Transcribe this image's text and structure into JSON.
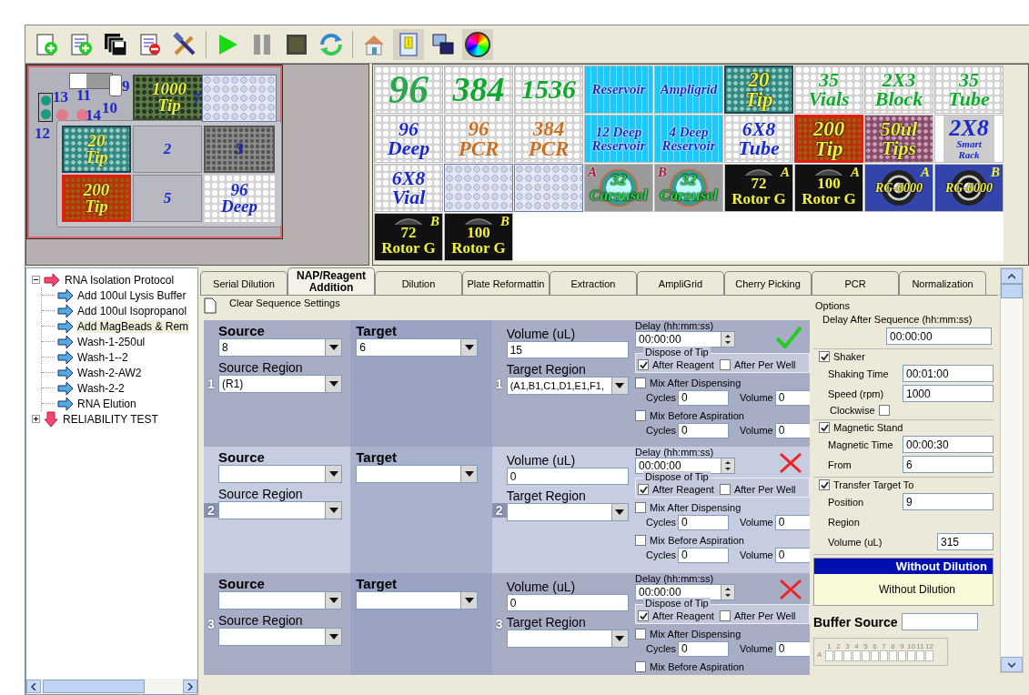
{
  "deck": {
    "labels": [
      "13",
      "11",
      "9",
      "10",
      "14",
      "12",
      "7"
    ],
    "slots": [
      {
        "kind": "tip-green",
        "lines": [
          "1000",
          "Tip"
        ]
      },
      {
        "kind": "holes-large"
      },
      {
        "kind": "tip-teal",
        "lines": [
          "20",
          "Tip"
        ]
      },
      {
        "kind": "empty",
        "lines": [
          "2"
        ]
      },
      {
        "kind": "plate-grey",
        "lines": [
          "3"
        ]
      },
      {
        "kind": "tip-red",
        "lines": [
          "200",
          "Tip"
        ]
      },
      {
        "kind": "empty",
        "lines": [
          "5"
        ]
      },
      {
        "kind": "plate",
        "lines": [
          "96",
          "Deep"
        ]
      }
    ]
  },
  "palette": {
    "tiles": [
      {
        "kind": "plate",
        "lines": [
          "96"
        ],
        "color": "#2aa84a"
      },
      {
        "kind": "plate",
        "lines": [
          "384"
        ],
        "color": "#12a830"
      },
      {
        "kind": "plate",
        "lines": [
          "1536"
        ],
        "color": "#12a830"
      },
      {
        "kind": "reservoir",
        "lines": [
          "Reservoir"
        ],
        "color": "#1a2ac8"
      },
      {
        "kind": "reservoir",
        "lines": [
          "Ampligrid"
        ],
        "color": "#1a2ac8"
      },
      {
        "kind": "tip-teal",
        "lines": [
          "20",
          "Tip"
        ],
        "color": "#e8f040"
      },
      {
        "kind": "plate",
        "lines": [
          "35",
          "Vials"
        ],
        "color": "#12a830"
      },
      {
        "kind": "plate",
        "lines": [
          "2X3",
          "Block"
        ],
        "color": "#12a830"
      },
      {
        "kind": "plate",
        "lines": [
          "35",
          "Tube"
        ],
        "color": "#12a830"
      },
      {
        "kind": "plate",
        "lines": [
          "96",
          "Deep"
        ],
        "color": "#1a2ac8"
      },
      {
        "kind": "plate",
        "lines": [
          "96",
          "PCR"
        ],
        "color": "#c87020"
      },
      {
        "kind": "plate",
        "lines": [
          "384",
          "PCR"
        ],
        "color": "#c87020"
      },
      {
        "kind": "reservoir",
        "lines": [
          "12 Deep",
          "Reservoir"
        ],
        "color": "#1a2ac8"
      },
      {
        "kind": "reservoir",
        "lines": [
          "4 Deep",
          "Reservoir"
        ],
        "color": "#1a2ac8"
      },
      {
        "kind": "plate",
        "lines": [
          "6X8",
          "Tube"
        ],
        "color": "#1a2ac8"
      },
      {
        "kind": "tip-red",
        "lines": [
          "200",
          "Tip"
        ],
        "color": "#e8f040"
      },
      {
        "kind": "tip-purple",
        "lines": [
          "50ul",
          "Tips"
        ],
        "color": "#e8f040"
      },
      {
        "kind": "rack",
        "lines": [
          "2X8"
        ],
        "sub": [
          "Smart",
          "Rack"
        ],
        "color": "#1a2ac8"
      },
      {
        "kind": "plate",
        "lines": [
          "6X8",
          "Vial"
        ],
        "color": "#1a2ac8"
      },
      {
        "kind": "holes-small"
      },
      {
        "kind": "holes-large"
      },
      {
        "kind": "carousel",
        "lines": [
          "32",
          "Carousel"
        ],
        "corner": "A",
        "color": "#22dd44"
      },
      {
        "kind": "carousel",
        "lines": [
          "32",
          "Carousel"
        ],
        "corner": "B",
        "color": "#22dd44"
      },
      {
        "kind": "rotor",
        "lines": [
          "72",
          "Rotor G"
        ],
        "corner": "A",
        "color": "#f0f040"
      },
      {
        "kind": "rotor",
        "lines": [
          "100",
          "Rotor G"
        ],
        "corner": "A",
        "color": "#f0f040"
      },
      {
        "kind": "rg",
        "lines": [
          "RG-6000"
        ],
        "corner": "A",
        "color": "#f0f040"
      },
      {
        "kind": "rg",
        "lines": [
          "RG-6000"
        ],
        "corner": "B",
        "color": "#f0f040"
      },
      {
        "kind": "rotor",
        "lines": [
          "72",
          "Rotor G"
        ],
        "corner": "B",
        "color": "#f0f040"
      },
      {
        "kind": "rotor",
        "lines": [
          "100",
          "Rotor G"
        ],
        "corner": "B",
        "color": "#f0f040"
      }
    ]
  },
  "tree": {
    "nodes": [
      {
        "label": "RNA Isolation Protocol",
        "expanded": true,
        "selected": false,
        "children": [
          {
            "label": "Add 100ul Lysis Buffer",
            "selected": false
          },
          {
            "label": "Add 100ul Isopropanol",
            "selected": false
          },
          {
            "label": "Add MagBeads & Rem",
            "selected": true
          },
          {
            "label": "Wash-1-250ul",
            "selected": false
          },
          {
            "label": "Wash-1--2",
            "selected": false
          },
          {
            "label": "Wash-2-AW2",
            "selected": false
          },
          {
            "label": "Wash-2-2",
            "selected": false
          },
          {
            "label": "RNA Elution",
            "selected": false
          }
        ]
      },
      {
        "label": "RELIABILITY TEST",
        "expanded": false,
        "selected": false
      }
    ]
  },
  "tabs": [
    {
      "label": "Serial Dilution",
      "selected": false
    },
    {
      "label": "NAP/Reagent Addition",
      "selected": true
    },
    {
      "label": "Dilution",
      "selected": false
    },
    {
      "label": "Plate Reformattin",
      "selected": false
    },
    {
      "label": "Extraction",
      "selected": false
    },
    {
      "label": "AmpliGrid",
      "selected": false
    },
    {
      "label": "Cherry Picking",
      "selected": false
    },
    {
      "label": "PCR",
      "selected": false
    },
    {
      "label": "Normalization",
      "selected": false
    }
  ],
  "clear_button": "Clear Sequence Settings",
  "sequences": [
    {
      "source": {
        "label": "Source",
        "value": "8",
        "number": "1"
      },
      "source_region": {
        "label": "Source Region",
        "value": "(R1)"
      },
      "target": {
        "label": "Target",
        "value": "6"
      },
      "volume": {
        "label": "Volume (uL)",
        "value": "15",
        "number": "1"
      },
      "target_region": {
        "label": "Target Region",
        "value": "(A1,B1,C1,D1,E1,F1,"
      },
      "delay": {
        "label": "Delay (hh:mm:ss)",
        "value": "00:00:00"
      },
      "valid": true,
      "dispose": {
        "title": "Dispose of Tip",
        "options": [
          {
            "label": "After Reagent",
            "checked": true
          },
          {
            "label": "After Per Well",
            "checked": false
          }
        ]
      },
      "mixes": [
        {
          "label": "Mix After Dispensing",
          "checked": false,
          "cycles_label": "Cycles",
          "cycles": "0",
          "volume_label": "Volume",
          "volume": "0"
        },
        {
          "label": "Mix Before Aspiration",
          "checked": false,
          "cycles_label": "Cycles",
          "cycles": "0",
          "volume_label": "Volume",
          "volume": "0"
        }
      ]
    },
    {
      "source": {
        "label": "Source",
        "number": "2"
      },
      "source_region": {
        "label": "Source Region"
      },
      "target": {
        "label": "Target"
      },
      "volume": {
        "label": "Volume (uL)",
        "value": "0",
        "number": "2"
      },
      "target_region": {
        "label": "Target Region"
      },
      "delay": {
        "label": "Delay (hh:mm:ss)",
        "value": "00:00:00"
      },
      "valid": false,
      "dispose": {
        "title": "Dispose of Tip",
        "options": [
          {
            "label": "After Reagent",
            "checked": true
          },
          {
            "label": "After Per Well",
            "checked": false
          }
        ]
      },
      "mixes": [
        {
          "label": "Mix After Dispensing",
          "checked": false,
          "cycles_label": "Cycles",
          "cycles": "0",
          "volume_label": "Volume",
          "volume": "0"
        },
        {
          "label": "Mix Before Aspiration",
          "checked": false,
          "cycles_label": "Cycles",
          "cycles": "0",
          "volume_label": "Volume",
          "volume": "0"
        }
      ]
    },
    {
      "source": {
        "label": "Source",
        "number": "3"
      },
      "source_region": {
        "label": "Source Region"
      },
      "target": {
        "label": "Target"
      },
      "volume": {
        "label": "Volume (uL)",
        "value": "0",
        "number": "3"
      },
      "target_region": {
        "label": "Target Region"
      },
      "delay": {
        "label": "Delay (hh:mm:ss)",
        "value": "00:00:00"
      },
      "valid": false,
      "dispose": {
        "title": "Dispose of Tip",
        "options": [
          {
            "label": "After Reagent",
            "checked": true
          },
          {
            "label": "After Per Well",
            "checked": false
          }
        ]
      },
      "mixes": [
        {
          "label": "Mix After Dispensing",
          "checked": false,
          "cycles_label": "Cycles",
          "cycles": "0",
          "volume_label": "Volume",
          "volume": "0"
        },
        {
          "label": "Mix Before Aspiration",
          "checked": false
        }
      ]
    }
  ],
  "options": {
    "title": "Options",
    "delay_label": "Delay After Sequence (hh:mm:ss)",
    "delay": "00:00:00",
    "groups": [
      {
        "label": "Shaker",
        "checked": true,
        "fields": [
          {
            "label": "Shaking Time",
            "value": "00:01:00"
          },
          {
            "label": "Speed (rpm)",
            "value": "1000"
          }
        ],
        "toggle": {
          "label": "Clockwise",
          "checked": false
        }
      },
      {
        "label": "Magnetic Stand",
        "checked": true,
        "fields": [
          {
            "label": "Magnetic Time",
            "value": "00:00:30"
          },
          {
            "label": "From",
            "value": "6"
          }
        ]
      },
      {
        "label": "Transfer Target To",
        "checked": true,
        "fields": [
          {
            "label": "Position",
            "value": "9"
          },
          {
            "label": "Region"
          },
          {
            "label": "Volume (uL)",
            "value": "315"
          }
        ]
      }
    ]
  },
  "dilution": {
    "header": "Without Dilution",
    "body": "Without Dilution"
  },
  "buffer": {
    "label": "Buffer Source"
  },
  "plate_grid": {
    "columns": [
      "1",
      "2",
      "3",
      "4",
      "5",
      "6",
      "7",
      "8",
      "9",
      "10",
      "11",
      "12"
    ],
    "rows": [
      "A"
    ]
  }
}
